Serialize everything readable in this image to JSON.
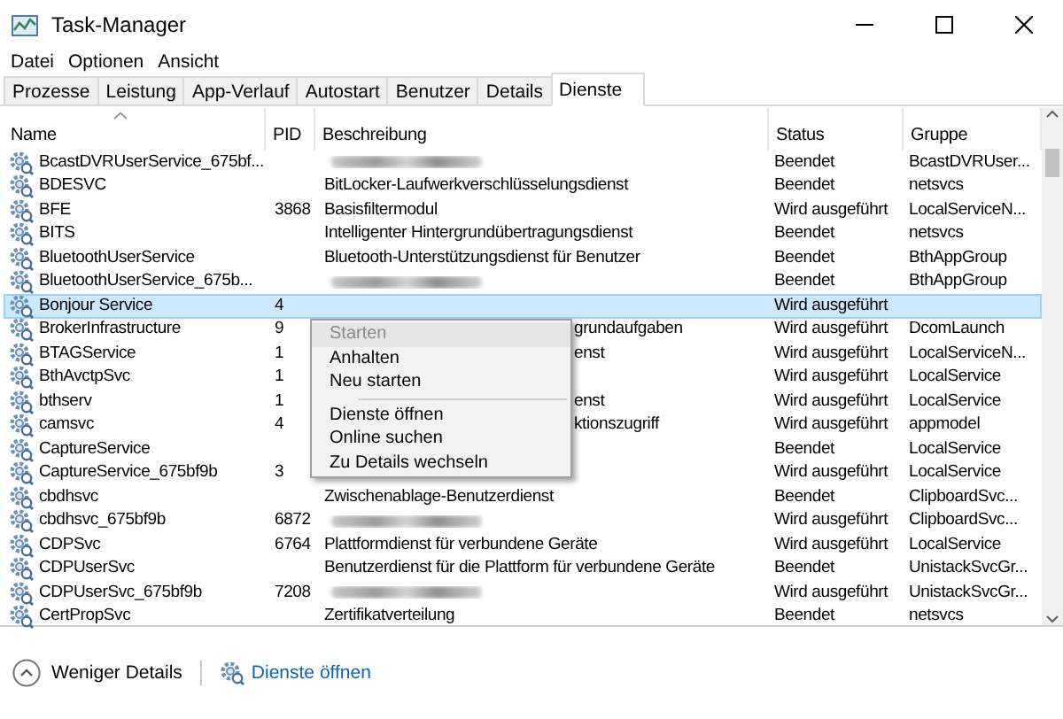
{
  "window": {
    "title": "Task-Manager"
  },
  "menu_bar": [
    "Datei",
    "Optionen",
    "Ansicht"
  ],
  "tabs": [
    {
      "label": "Prozesse",
      "selected": false
    },
    {
      "label": "Leistung",
      "selected": false
    },
    {
      "label": "App-Verlauf",
      "selected": false
    },
    {
      "label": "Autostart",
      "selected": false
    },
    {
      "label": "Benutzer",
      "selected": false
    },
    {
      "label": "Details",
      "selected": false
    },
    {
      "label": "Dienste",
      "selected": true
    }
  ],
  "table": {
    "columns": [
      "Name",
      "PID",
      "Beschreibung",
      "Status",
      "Gruppe"
    ],
    "rows": [
      {
        "name": "BcastDVRUserService_675bf...",
        "pid": "",
        "description": "",
        "description_blurred": true,
        "status": "Beendet",
        "group": "BcastDVRUser...",
        "selected": false
      },
      {
        "name": "BDESVC",
        "pid": "",
        "description": "BitLocker-Laufwerkverschlüsselungsdienst",
        "status": "Beendet",
        "group": "netsvcs",
        "selected": false
      },
      {
        "name": "BFE",
        "pid": "3868",
        "description": "Basisfiltermodul",
        "status": "Wird ausgeführt",
        "group": "LocalServiceN...",
        "selected": false
      },
      {
        "name": "BITS",
        "pid": "",
        "description": "Intelligenter Hintergrundübertragungsdienst",
        "status": "Beendet",
        "group": "netsvcs",
        "selected": false
      },
      {
        "name": "BluetoothUserService",
        "pid": "",
        "description": "Bluetooth-Unterstützungsdienst für Benutzer",
        "status": "Beendet",
        "group": "BthAppGroup",
        "selected": false
      },
      {
        "name": "BluetoothUserService_675b...",
        "pid": "",
        "description": "",
        "description_blurred": true,
        "status": "Beendet",
        "group": "BthAppGroup",
        "selected": false
      },
      {
        "name": "Bonjour Service",
        "pid": "4",
        "description": "",
        "status": "Wird ausgeführt",
        "group": "",
        "selected": true
      },
      {
        "name": "BrokerInfrastructure",
        "pid": "9",
        "description": "grundaufgaben",
        "description_covered": true,
        "status": "Wird ausgeführt",
        "group": "DcomLaunch",
        "selected": false
      },
      {
        "name": "BTAGService",
        "pid": "1",
        "description": "enst",
        "description_covered": true,
        "status": "Wird ausgeführt",
        "group": "LocalServiceN...",
        "selected": false
      },
      {
        "name": "BthAvctpSvc",
        "pid": "1",
        "description": "",
        "status": "Wird ausgeführt",
        "group": "LocalService",
        "selected": false
      },
      {
        "name": "bthserv",
        "pid": "1",
        "description": "enst",
        "description_covered": true,
        "status": "Wird ausgeführt",
        "group": "LocalService",
        "selected": false
      },
      {
        "name": "camsvc",
        "pid": "4",
        "description": "ktionszugriff",
        "description_covered": true,
        "status": "Wird ausgeführt",
        "group": "appmodel",
        "selected": false
      },
      {
        "name": "CaptureService",
        "pid": "",
        "description": "",
        "status": "Beendet",
        "group": "LocalService",
        "selected": false
      },
      {
        "name": "CaptureService_675bf9b",
        "pid": "3",
        "description": "",
        "status": "Wird ausgeführt",
        "group": "LocalService",
        "selected": false
      },
      {
        "name": "cbdhsvc",
        "pid": "",
        "description": "Zwischenablage-Benutzerdienst",
        "status": "Beendet",
        "group": "ClipboardSvc...",
        "selected": false
      },
      {
        "name": "cbdhsvc_675bf9b",
        "pid": "6872",
        "description": "",
        "description_blurred": true,
        "status": "Wird ausgeführt",
        "group": "ClipboardSvc...",
        "selected": false
      },
      {
        "name": "CDPSvc",
        "pid": "6764",
        "description": "Plattformdienst für verbundene Geräte",
        "status": "Wird ausgeführt",
        "group": "LocalService",
        "selected": false
      },
      {
        "name": "CDPUserSvc",
        "pid": "",
        "description": "Benutzerdienst für die Plattform für verbundene Geräte",
        "status": "Beendet",
        "group": "UnistackSvcGr...",
        "selected": false
      },
      {
        "name": "CDPUserSvc_675bf9b",
        "pid": "7208",
        "description": "",
        "description_blurred": true,
        "status": "Wird ausgeführt",
        "group": "UnistackSvcGr...",
        "selected": false
      },
      {
        "name": "CertPropSvc",
        "pid": "",
        "description": "Zertifikatverteilung",
        "status": "Beendet",
        "group": "netsvcs",
        "selected": false
      }
    ]
  },
  "context_menu": [
    {
      "kind": "item",
      "label": "Starten",
      "disabled": true
    },
    {
      "kind": "item",
      "label": "Anhalten",
      "disabled": false
    },
    {
      "kind": "item",
      "label": "Neu starten",
      "disabled": false
    },
    {
      "kind": "separator"
    },
    {
      "kind": "item",
      "label": "Dienste öffnen",
      "disabled": false
    },
    {
      "kind": "item",
      "label": "Online suchen",
      "disabled": false
    },
    {
      "kind": "item",
      "label": "Zu Details wechseln",
      "disabled": false
    }
  ],
  "footer": {
    "toggle": "Weniger Details",
    "link": "Dienste öffnen"
  }
}
